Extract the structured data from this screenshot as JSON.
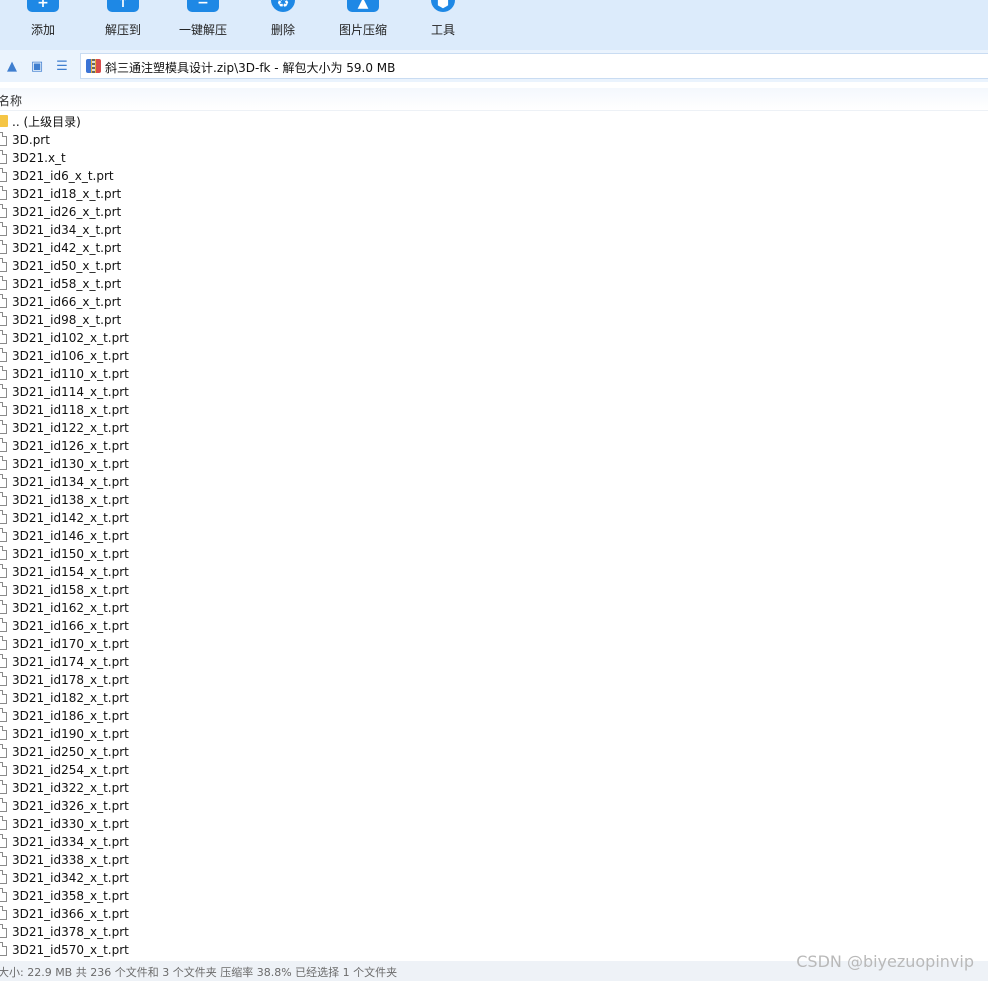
{
  "toolbar": {
    "buttons": [
      {
        "label": "添加",
        "icon": "add-icon",
        "glyph": "+"
      },
      {
        "label": "解压到",
        "icon": "extract-to-icon",
        "glyph": "↑"
      },
      {
        "label": "一键解压",
        "icon": "one-click-extract-icon",
        "glyph": "−"
      },
      {
        "label": "删除",
        "icon": "delete-icon",
        "glyph": "♻"
      },
      {
        "label": "图片压缩",
        "icon": "image-compress-icon",
        "glyph": "▲"
      },
      {
        "label": "工具",
        "icon": "tools-icon",
        "glyph": "⬢"
      }
    ]
  },
  "addressbar": {
    "path": "斜三通注塑模具设计.zip\\3D-fk - 解包大小为 59.0 MB"
  },
  "list_header": {
    "name_column": "名称"
  },
  "files": [
    {
      "name": ".. (上级目录)",
      "type": "folder"
    },
    {
      "name": "3D.prt",
      "type": "file"
    },
    {
      "name": "3D21.x_t",
      "type": "file"
    },
    {
      "name": "3D21_id6_x_t.prt",
      "type": "file"
    },
    {
      "name": "3D21_id18_x_t.prt",
      "type": "file"
    },
    {
      "name": "3D21_id26_x_t.prt",
      "type": "file"
    },
    {
      "name": "3D21_id34_x_t.prt",
      "type": "file"
    },
    {
      "name": "3D21_id42_x_t.prt",
      "type": "file"
    },
    {
      "name": "3D21_id50_x_t.prt",
      "type": "file"
    },
    {
      "name": "3D21_id58_x_t.prt",
      "type": "file"
    },
    {
      "name": "3D21_id66_x_t.prt",
      "type": "file"
    },
    {
      "name": "3D21_id98_x_t.prt",
      "type": "file"
    },
    {
      "name": "3D21_id102_x_t.prt",
      "type": "file"
    },
    {
      "name": "3D21_id106_x_t.prt",
      "type": "file"
    },
    {
      "name": "3D21_id110_x_t.prt",
      "type": "file"
    },
    {
      "name": "3D21_id114_x_t.prt",
      "type": "file"
    },
    {
      "name": "3D21_id118_x_t.prt",
      "type": "file"
    },
    {
      "name": "3D21_id122_x_t.prt",
      "type": "file"
    },
    {
      "name": "3D21_id126_x_t.prt",
      "type": "file"
    },
    {
      "name": "3D21_id130_x_t.prt",
      "type": "file"
    },
    {
      "name": "3D21_id134_x_t.prt",
      "type": "file"
    },
    {
      "name": "3D21_id138_x_t.prt",
      "type": "file"
    },
    {
      "name": "3D21_id142_x_t.prt",
      "type": "file"
    },
    {
      "name": "3D21_id146_x_t.prt",
      "type": "file"
    },
    {
      "name": "3D21_id150_x_t.prt",
      "type": "file"
    },
    {
      "name": "3D21_id154_x_t.prt",
      "type": "file"
    },
    {
      "name": "3D21_id158_x_t.prt",
      "type": "file"
    },
    {
      "name": "3D21_id162_x_t.prt",
      "type": "file"
    },
    {
      "name": "3D21_id166_x_t.prt",
      "type": "file"
    },
    {
      "name": "3D21_id170_x_t.prt",
      "type": "file"
    },
    {
      "name": "3D21_id174_x_t.prt",
      "type": "file"
    },
    {
      "name": "3D21_id178_x_t.prt",
      "type": "file"
    },
    {
      "name": "3D21_id182_x_t.prt",
      "type": "file"
    },
    {
      "name": "3D21_id186_x_t.prt",
      "type": "file"
    },
    {
      "name": "3D21_id190_x_t.prt",
      "type": "file"
    },
    {
      "name": "3D21_id250_x_t.prt",
      "type": "file"
    },
    {
      "name": "3D21_id254_x_t.prt",
      "type": "file"
    },
    {
      "name": "3D21_id322_x_t.prt",
      "type": "file"
    },
    {
      "name": "3D21_id326_x_t.prt",
      "type": "file"
    },
    {
      "name": "3D21_id330_x_t.prt",
      "type": "file"
    },
    {
      "name": "3D21_id334_x_t.prt",
      "type": "file"
    },
    {
      "name": "3D21_id338_x_t.prt",
      "type": "file"
    },
    {
      "name": "3D21_id342_x_t.prt",
      "type": "file"
    },
    {
      "name": "3D21_id358_x_t.prt",
      "type": "file"
    },
    {
      "name": "3D21_id366_x_t.prt",
      "type": "file"
    },
    {
      "name": "3D21_id378_x_t.prt",
      "type": "file"
    },
    {
      "name": "3D21_id570_x_t.prt",
      "type": "file"
    }
  ],
  "statusbar": {
    "text": "大小: 22.9 MB 共 236 个文件和 3 个文件夹 压缩率 38.8% 已经选择 1 个文件夹"
  },
  "watermark": "CSDN @biyezuopinvip",
  "colors": {
    "toolbar_bg": "#dcebfb",
    "accent": "#1e88e5",
    "folder": "#f5c545"
  }
}
